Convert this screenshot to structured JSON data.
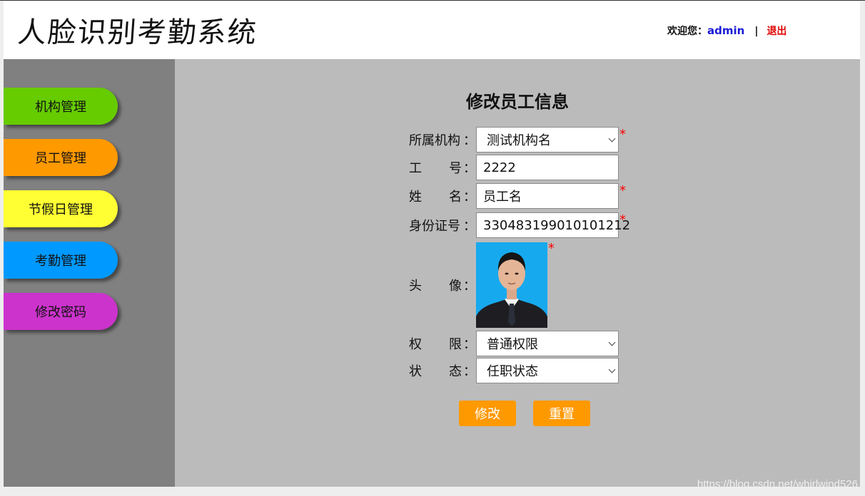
{
  "header": {
    "app_title": "人脸识别考勤系统",
    "welcome_label": "欢迎您：",
    "username": "admin",
    "separator": "|",
    "logout_label": "退出"
  },
  "sidebar": {
    "items": [
      {
        "label": "机构管理",
        "color": "#66cc00"
      },
      {
        "label": "员工管理",
        "color": "#ff9900"
      },
      {
        "label": "节假日管理",
        "color": "#ffff33"
      },
      {
        "label": "考勤管理",
        "color": "#0099ff"
      },
      {
        "label": "修改密码",
        "color": "#cc33cc"
      }
    ]
  },
  "form": {
    "title": "修改员工信息",
    "required_mark": "*",
    "org_label": "所属机构",
    "org_value": "测试机构名",
    "empno_label_a": "工",
    "empno_label_b": "号",
    "empno_value": "2222",
    "name_label_a": "姓",
    "name_label_b": "名",
    "name_value": "员工名",
    "idcard_label": "身份证号",
    "idcard_value": "330483199010101212",
    "photo_label_a": "头",
    "photo_label_b": "像",
    "perm_label_a": "权",
    "perm_label_b": "限",
    "perm_value": "普通权限",
    "status_label_a": "状",
    "status_label_b": "态",
    "status_value": "任职状态",
    "colon": "：",
    "submit_label": "修改",
    "reset_label": "重置"
  },
  "watermark": "https://blog.csdn.net/whirlwind526"
}
